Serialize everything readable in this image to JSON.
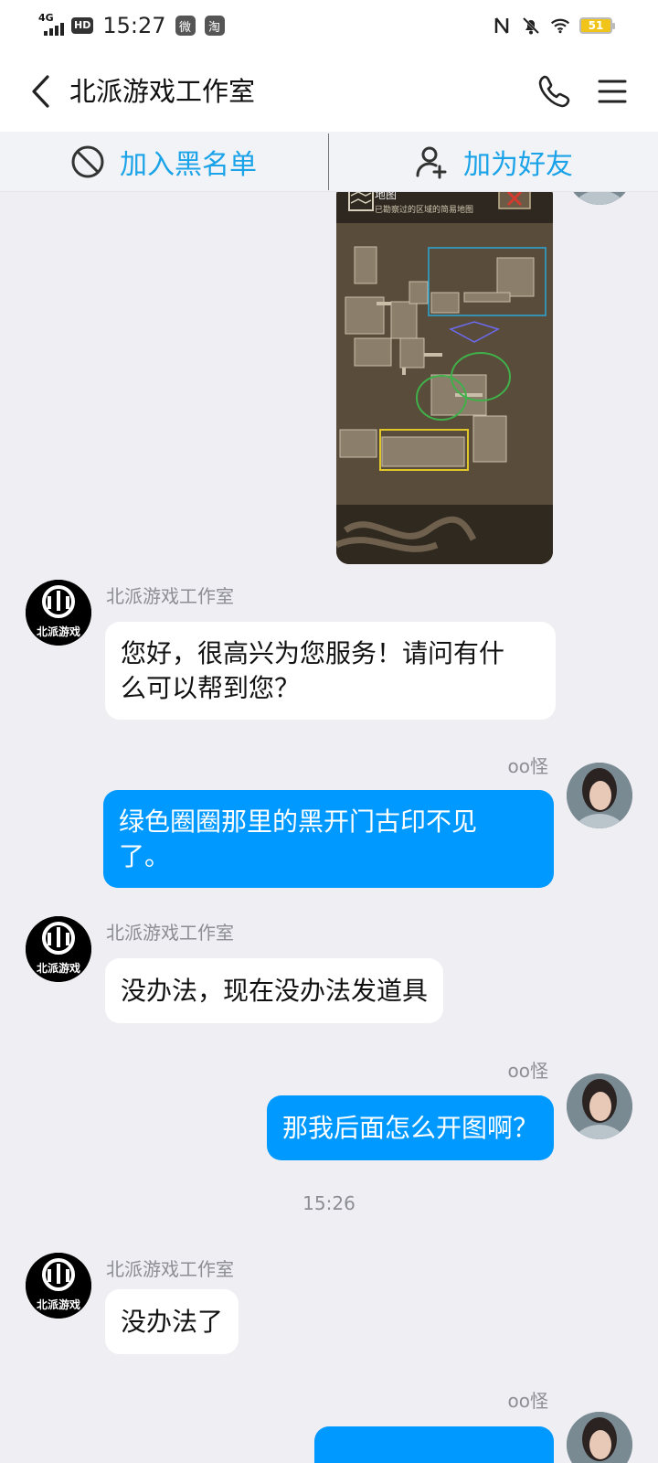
{
  "status_bar": {
    "network": "4G",
    "hd": "HD",
    "time": "15:27",
    "app_icon_1": "微",
    "app_icon_2": "淘",
    "battery": "51"
  },
  "header": {
    "title": "北派游戏工作室"
  },
  "actions": {
    "blacklist_label": "加入黑名单",
    "add_friend_label": "加为好友"
  },
  "map_image": {
    "title": "地图",
    "subtitle": "已勘察过的区域的简易地图"
  },
  "messages": [
    {
      "sender": "北派游戏工作室",
      "direction": "in",
      "text": "您好，很高兴为您服务！请问有什么可以帮到您？",
      "lines": [
        "您好，很高兴为您服务！请问有什",
        "么可以帮到您？"
      ]
    },
    {
      "sender": "oo怪",
      "direction": "out",
      "text": "绿色圈圈那里的黑开门古印不见了。",
      "lines": [
        "绿色圈圈那里的黑开门古印不见",
        "了。"
      ]
    },
    {
      "sender": "北派游戏工作室",
      "direction": "in",
      "text": "没办法，现在没办法发道具"
    },
    {
      "sender": "oo怪",
      "direction": "out",
      "text": "那我后面怎么开图啊？"
    },
    {
      "sender": "北派游戏工作室",
      "direction": "in",
      "text": "没办法了"
    },
    {
      "sender": "oo怪",
      "direction": "out",
      "text": ""
    }
  ],
  "time_divider": "15:26",
  "avatar_text": "北派游戏",
  "colors": {
    "accent": "#0099ff",
    "link": "#1aa3e8",
    "background": "#eeeef3"
  }
}
